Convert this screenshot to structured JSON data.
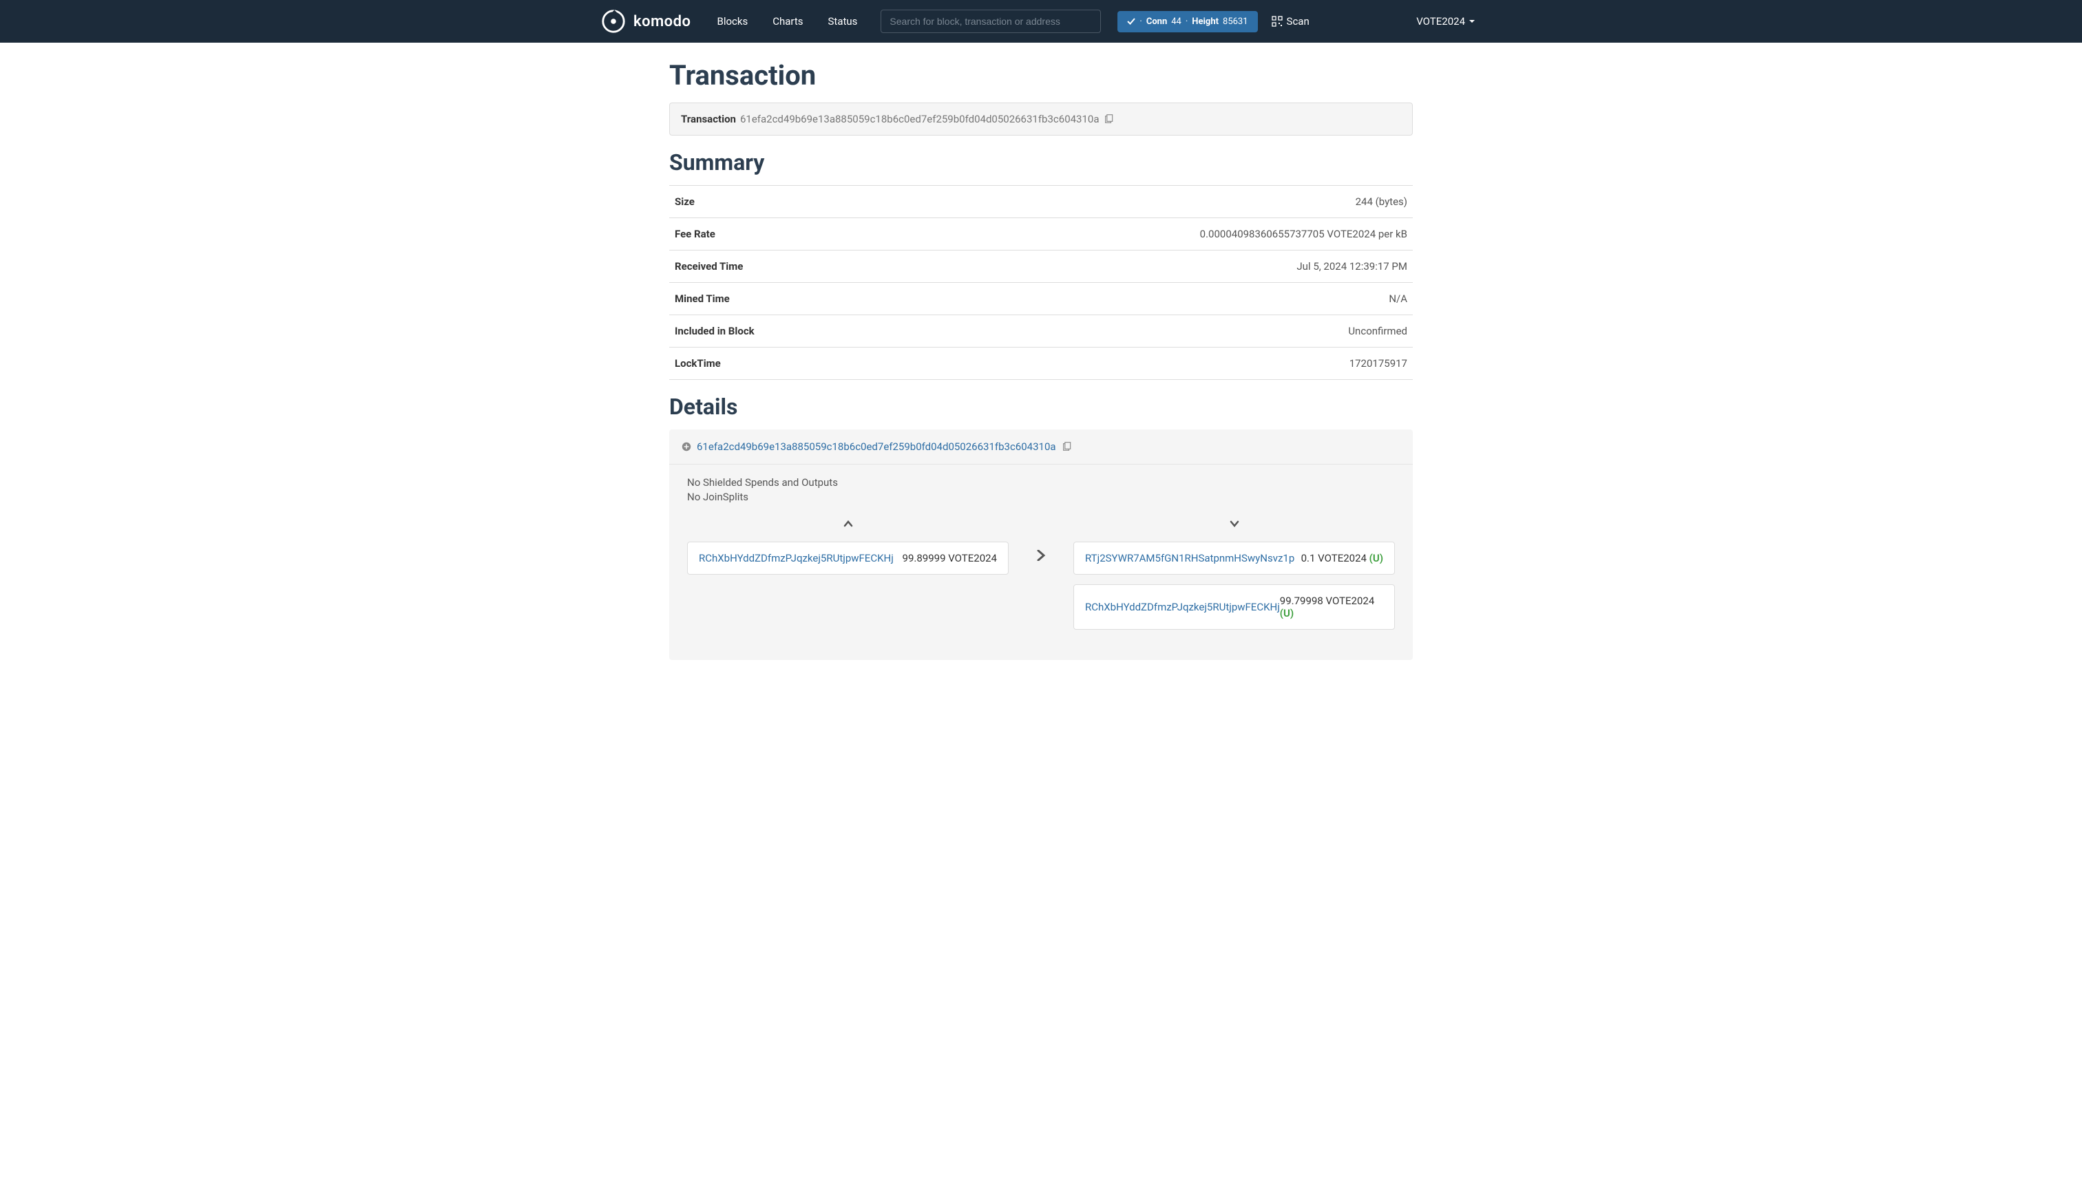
{
  "nav": {
    "brand": "komodo",
    "links": {
      "blocks": "Blocks",
      "charts": "Charts",
      "status": "Status"
    },
    "search_placeholder": "Search for block, transaction or address",
    "status_badge": {
      "conn_label": "Conn",
      "conn_value": "44",
      "height_label": "Height",
      "height_value": "85631",
      "separator": "·"
    },
    "scan_label": "Scan",
    "network": "VOTE2024"
  },
  "page": {
    "title": "Transaction",
    "hash_label": "Transaction",
    "hash_value": "61efa2cd49b69e13a885059c18b6c0ed7ef259b0fd04d05026631fb3c604310a"
  },
  "summary": {
    "heading": "Summary",
    "rows": [
      {
        "label": "Size",
        "value": "244 (bytes)"
      },
      {
        "label": "Fee Rate",
        "value": "0.00004098360655737705 VOTE2024 per kB"
      },
      {
        "label": "Received Time",
        "value": "Jul 5, 2024 12:39:17 PM"
      },
      {
        "label": "Mined Time",
        "value": "N/A"
      },
      {
        "label": "Included in Block",
        "value": "Unconfirmed"
      },
      {
        "label": "LockTime",
        "value": "1720175917"
      }
    ]
  },
  "details": {
    "heading": "Details",
    "hash": "61efa2cd49b69e13a885059c18b6c0ed7ef259b0fd04d05026631fb3c604310a",
    "shielded_note": "No Shielded Spends and Outputs",
    "joinsplits_note": "No JoinSplits",
    "inputs": [
      {
        "address": "RChXbHYddZDfmzPJqzkej5RUtjpwFECKHj",
        "amount": "99.89999 VOTE2024"
      }
    ],
    "outputs": [
      {
        "address": "RTj2SYWR7AM5fGN1RHSatpnmHSwyNsvz1p",
        "amount": "0.1 VOTE2024",
        "unspent": "(U)"
      },
      {
        "address": "RChXbHYddZDfmzPJqzkej5RUtjpwFECKHj",
        "amount": "99.79998 VOTE2024",
        "unspent": "(U)"
      }
    ]
  }
}
